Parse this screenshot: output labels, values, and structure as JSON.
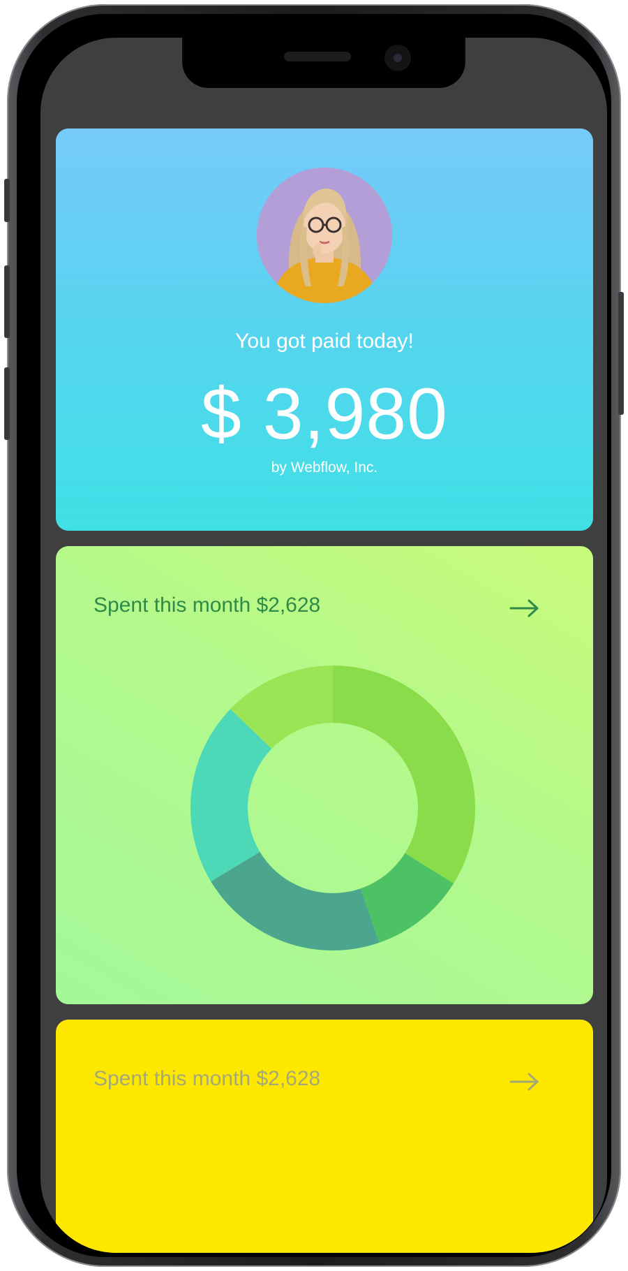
{
  "paid_card": {
    "title": "You got paid today!",
    "amount": "$ 3,980",
    "payer": "by Webflow, Inc."
  },
  "spent_card": {
    "title": "Spent this month $2,628",
    "arrow_icon": "arrow-right-icon",
    "title_color": "#2f8a4a",
    "donut_segments": [
      {
        "start_deg": 0,
        "end_deg": 122,
        "color": "#8adc4a"
      },
      {
        "start_deg": 122,
        "end_deg": 161,
        "color": "#4cc264"
      },
      {
        "start_deg": 161,
        "end_deg": 239,
        "color": "#4ca68e"
      },
      {
        "start_deg": 239,
        "end_deg": 314,
        "color": "#4dd8b8"
      },
      {
        "start_deg": 314,
        "end_deg": 360,
        "color": "#9ae456"
      }
    ]
  },
  "yellow_card": {
    "title": "Spent this month $2,628",
    "arrow_icon": "arrow-right-icon",
    "title_color": "#a4a878"
  },
  "colors": {
    "screen_bg": "#3f3f3f",
    "paid_gradient_top": "#77caf9",
    "paid_gradient_bottom": "#3fe0e5",
    "spent_gradient": "#b3f98c",
    "yellow": "#ffe800"
  }
}
